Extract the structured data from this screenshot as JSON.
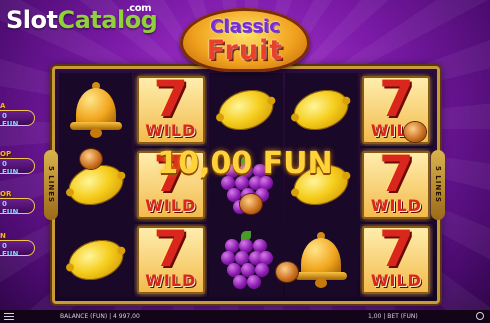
{
  "watermark": {
    "slot": "Slot",
    "catalog": "Catalog",
    "com": ".com"
  },
  "logo": {
    "line1": "Classic",
    "line2": "Fruit"
  },
  "jackpots": [
    {
      "label": "A",
      "value": "0 FUN"
    },
    {
      "label": "OP",
      "value": "0 FUN"
    },
    {
      "label": "OR",
      "value": "0 FUN"
    },
    {
      "label": "N",
      "value": "0 FUN"
    }
  ],
  "side_lines": {
    "left": "5 LINES",
    "right": "5 LINES"
  },
  "reels": [
    [
      "bell",
      "lemon",
      "lemon"
    ],
    [
      "wild",
      "wild",
      "wild"
    ],
    [
      "lemon",
      "grapes",
      "grapes"
    ],
    [
      "lemon",
      "lemon",
      "bell"
    ],
    [
      "wild",
      "wild",
      "wild"
    ]
  ],
  "wild_text": "WILD",
  "win": {
    "amount": "10,00 FUN"
  },
  "status_bar": {
    "balance_label": "BALANCE (FUN)",
    "balance_value": "4 997,00",
    "bet_value": "1,00",
    "bet_label": "BET (FUN)"
  },
  "colors": {
    "background": "#7a1aa6",
    "frame_gold": "#c79a3a",
    "win_text": "#ffd23a",
    "wild_red": "#d9271d"
  }
}
